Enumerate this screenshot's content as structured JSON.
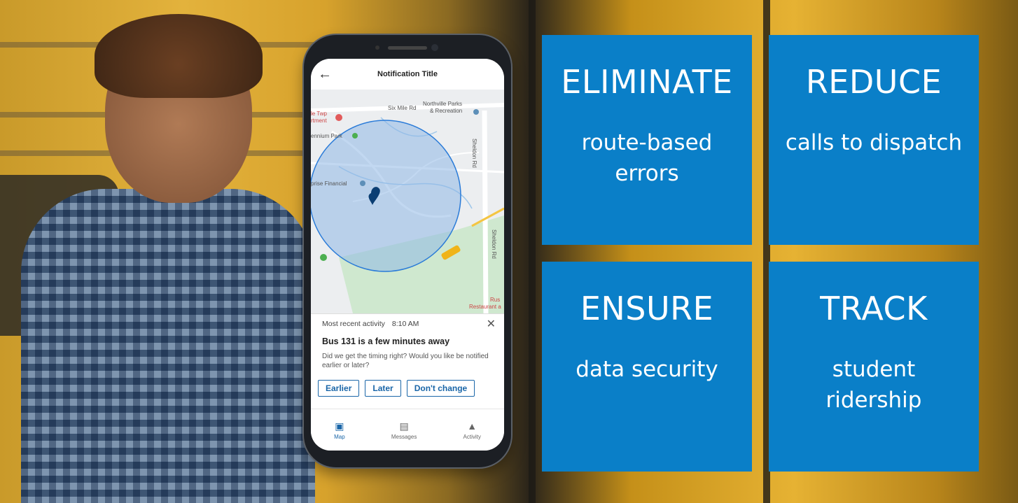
{
  "phone": {
    "title": "Notification Title",
    "back_icon": "arrow-left-icon",
    "map": {
      "labels": [
        "Six Mile Rd",
        "Northville Parks",
        "& Recreation",
        "le Twp",
        "rtment",
        "ennium Park",
        "prise Financial",
        "Sheldon Rd",
        "Sheldon Rd",
        "Rus",
        "Restaurant a"
      ]
    },
    "card": {
      "recent_label": "Most recent activity",
      "time": "8:10 AM",
      "title": "Bus 131 is a few minutes away",
      "body": "Did we get the timing right? Would you like be notified earlier or later?",
      "buttons": {
        "earlier": "Earlier",
        "later": "Later",
        "dont_change": "Don't change"
      }
    },
    "nav": {
      "map": "Map",
      "messages": "Messages",
      "activity": "Activity"
    }
  },
  "tiles": {
    "eliminate": {
      "title": "ELIMINATE",
      "sub": "route-based errors"
    },
    "reduce": {
      "title": "REDUCE",
      "sub": "calls to dispatch"
    },
    "ensure": {
      "title": "ENSURE",
      "sub": "data security"
    },
    "track": {
      "title": "TRACK",
      "sub": "student ridership"
    }
  },
  "colors": {
    "tile_blue": "#0a7fc8",
    "accent_blue": "#1a66a8",
    "geofence": "#2a7bd8"
  }
}
